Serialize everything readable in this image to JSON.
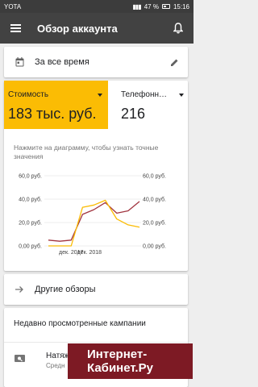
{
  "status_bar": {
    "carrier": "YOTA",
    "battery": "47 %",
    "time": "15:16"
  },
  "app_bar": {
    "title": "Обзор аккаунта",
    "menu_icon": "menu-icon",
    "bell_icon": "bell-icon"
  },
  "date_filter": {
    "label": "За все время",
    "icon": "calendar-icon",
    "edit_icon": "pencil-icon"
  },
  "metrics": [
    {
      "label": "Стоимость",
      "value": "183 тыс. руб.",
      "color": "#fbbc04"
    },
    {
      "label": "Телефонн…",
      "value": "216"
    }
  ],
  "chart_hint": "Нажмите на диаграмму, чтобы узнать точные значения",
  "chart_data": {
    "type": "line",
    "x_tick_labels": [
      "дек. 2017",
      "дек. 2018"
    ],
    "y_left_ticks": [
      "60,0 руб.",
      "40,0 руб.",
      "20,0 руб.",
      "0,00 руб."
    ],
    "y_right_ticks": [
      "60,0 руб.",
      "40,0 руб.",
      "20,0 руб.",
      "0,00 руб."
    ],
    "ylim": [
      0,
      60
    ],
    "series": [
      {
        "color": "#a1343f",
        "values": [
          5,
          4,
          5,
          27,
          31,
          37,
          28,
          30,
          38
        ]
      },
      {
        "color": "#fbbc04",
        "values": [
          0,
          0,
          0,
          33,
          35,
          39,
          23,
          18,
          16
        ]
      }
    ]
  },
  "other_reviews": {
    "label": "Другие обзоры",
    "icon": "arrow-right-icon"
  },
  "recent": {
    "title": "Недавно просмотренные кампании",
    "item_name": "Натяж",
    "item_sub": "Средн",
    "item_icon": "campaign-icon"
  },
  "watermark": {
    "line1": "Интернет-",
    "line2": "Кабинет.Ру"
  }
}
